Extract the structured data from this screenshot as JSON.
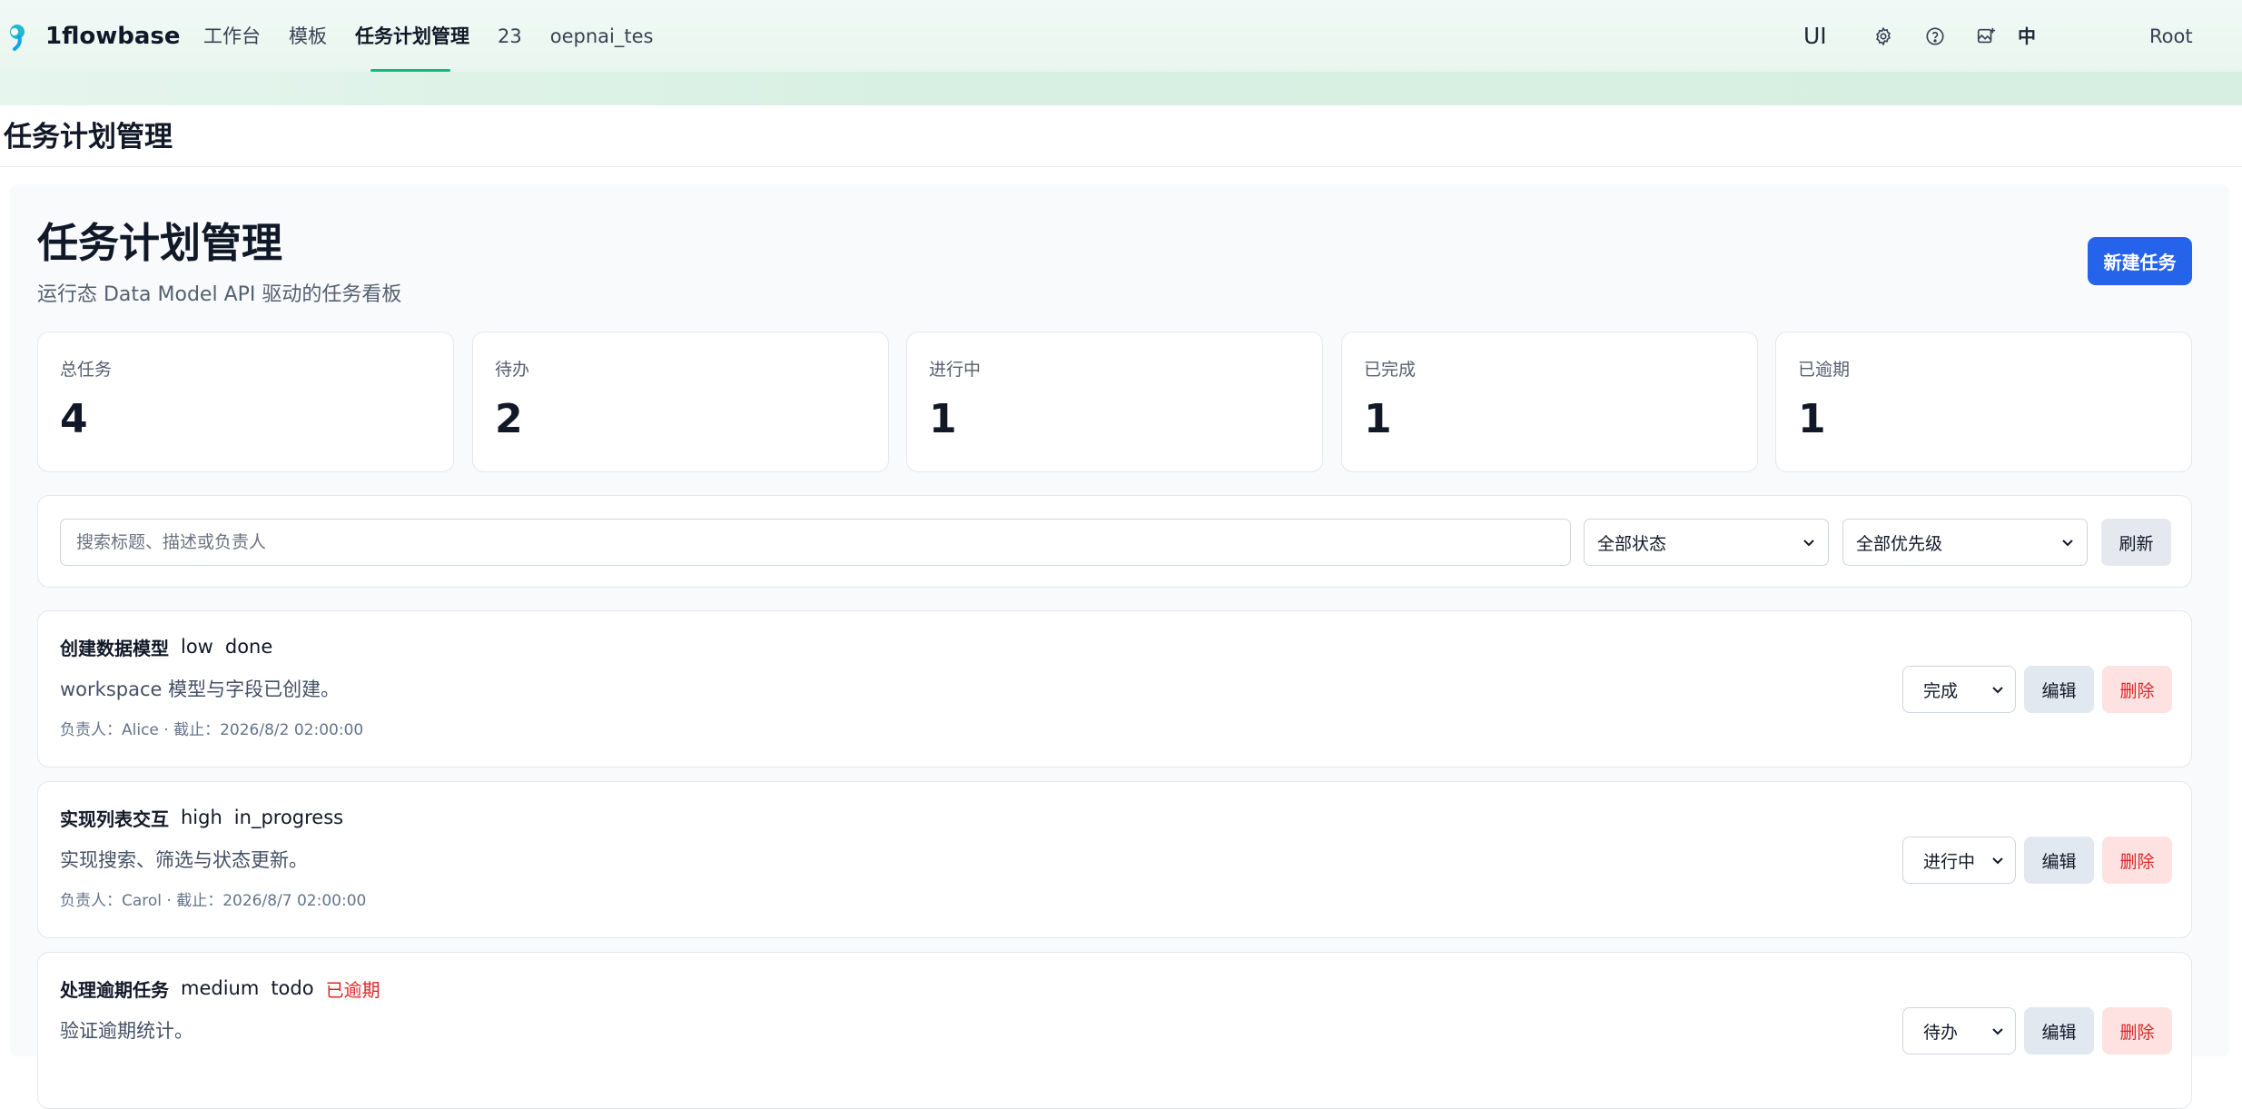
{
  "app": {
    "brand": "1flowbase",
    "nav": [
      {
        "label": "工作台"
      },
      {
        "label": "模板"
      },
      {
        "label": "任务计划管理",
        "active": true
      },
      {
        "label": "23"
      },
      {
        "label": "oepnai_tes"
      }
    ],
    "right": {
      "ui_label": "UI",
      "icons": [
        "gear-icon",
        "help-icon",
        "image-upload-icon"
      ],
      "language": "中",
      "user": "Root"
    },
    "accent_color": "#10b981"
  },
  "page": {
    "title": "任务计划管理"
  },
  "main": {
    "hero_title": "任务计划管理",
    "hero_subtitle": "运行态 Data Model API 驱动的任务看板",
    "new_task_label": "新建任务",
    "stats": [
      {
        "label": "总任务",
        "value": "4"
      },
      {
        "label": "待办",
        "value": "2"
      },
      {
        "label": "进行中",
        "value": "1"
      },
      {
        "label": "已完成",
        "value": "1"
      },
      {
        "label": "已逾期",
        "value": "1"
      }
    ],
    "filters": {
      "search_placeholder": "搜索标题、描述或负责人",
      "search_value": "",
      "status_selected": "全部状态",
      "priority_selected": "全部优先级",
      "refresh_label": "刷新"
    },
    "tasks": [
      {
        "title": "创建数据模型",
        "priority": "low",
        "status": "done",
        "overdue": "",
        "description": "workspace 模型与字段已创建。",
        "meta": "负责人：Alice · 截止：2026/8/2 02:00:00",
        "status_select": "完成",
        "edit_label": "编辑",
        "delete_label": "删除"
      },
      {
        "title": "实现列表交互",
        "priority": "high",
        "status": "in_progress",
        "overdue": "",
        "description": "实现搜索、筛选与状态更新。",
        "meta": "负责人：Carol · 截止：2026/8/7 02:00:00",
        "status_select": "进行中",
        "edit_label": "编辑",
        "delete_label": "删除"
      },
      {
        "title": "处理逾期任务",
        "priority": "medium",
        "status": "todo",
        "overdue": "已逾期",
        "description": "验证逾期统计。",
        "meta": "",
        "status_select": "待办",
        "edit_label": "编辑",
        "delete_label": "删除"
      }
    ]
  }
}
